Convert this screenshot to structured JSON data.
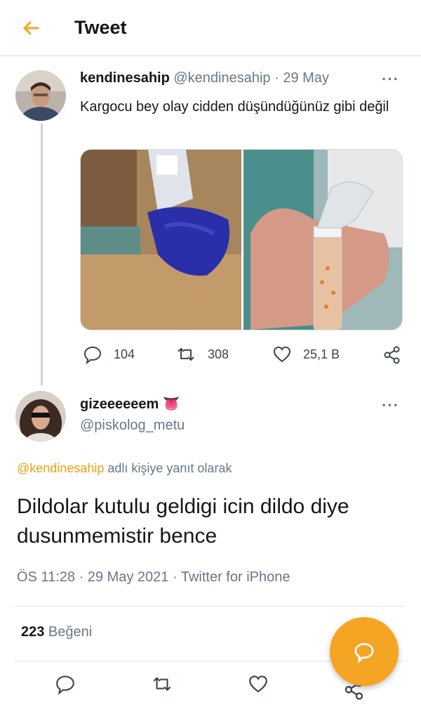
{
  "header": {
    "title": "Tweet"
  },
  "tweet1": {
    "name": "kendinesahip",
    "handle": "@kendinesahip",
    "date": "· 29 May",
    "text": "Kargocu bey olay cidden düşündüğünüz gibi değil",
    "media": [
      {
        "description": "package-photo-icon"
      },
      {
        "description": "product-photo-icon"
      }
    ],
    "stats": {
      "replies": "104",
      "retweets": "308",
      "likes": "25,1 B"
    }
  },
  "tweet2": {
    "name": "gizeeeeeem",
    "emoji": "👅",
    "handle": "@piskolog_metu",
    "reply_mention": "@kendinesahip",
    "reply_suffix": " adlı kişiye yanıt olarak",
    "text": "Dildolar kutulu geldigi icin dildo diye dusunmemistir bence",
    "meta": "ÖS 11:28 · 29 May 2021 · Twitter for iPhone",
    "like_count": "223",
    "like_label": " Beğeni"
  },
  "colors": {
    "accent": "#f5a524",
    "mention": "#e8a40c",
    "muted": "#6b7785"
  }
}
